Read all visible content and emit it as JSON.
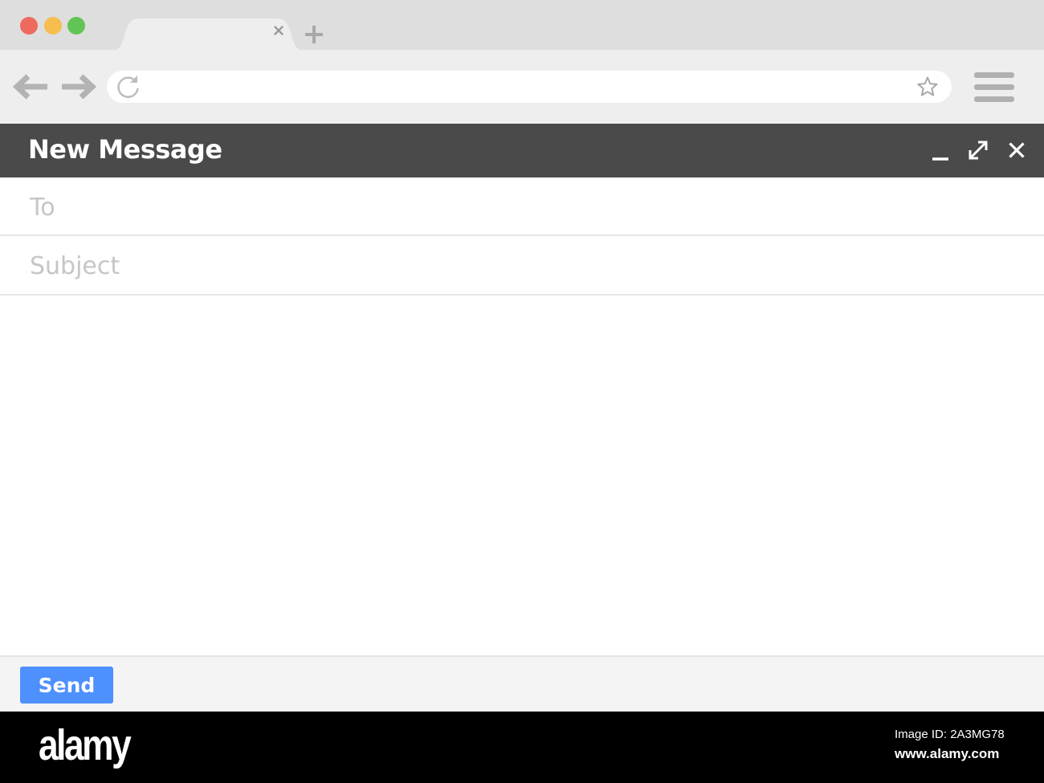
{
  "colors": {
    "tabbar_bg": "#dedede",
    "toolbar_bg": "#eeeeee",
    "traffic_red": "#ee6a5f",
    "traffic_yellow": "#f5be4f",
    "traffic_green": "#62c454",
    "header_bg": "#4a4a4a",
    "send_button": "#4d90fe",
    "placeholder": "#c6c6c6"
  },
  "browser": {
    "window_controls": [
      "close-dot",
      "minimize-dot",
      "zoom-dot"
    ],
    "tab": {
      "close_icon": "close-icon"
    },
    "new_tab_icon": "plus-icon",
    "nav": {
      "back_icon": "arrow-left-icon",
      "forward_icon": "arrow-right-icon",
      "reload_icon": "reload-icon"
    },
    "address_bar": {
      "value": "",
      "placeholder": ""
    },
    "bookmark_icon": "star-icon",
    "menu_icon": "hamburger-menu-icon"
  },
  "compose": {
    "title": "New Message",
    "header_icons": [
      "minimize-icon",
      "expand-icon",
      "close-icon"
    ],
    "to_placeholder": "To",
    "subject_placeholder": "Subject",
    "body_value": "",
    "send_label": "Send"
  },
  "watermark": {
    "logo": "alamy",
    "image_id": "Image ID: 2A3MG78",
    "url": "www.alamy.com"
  }
}
